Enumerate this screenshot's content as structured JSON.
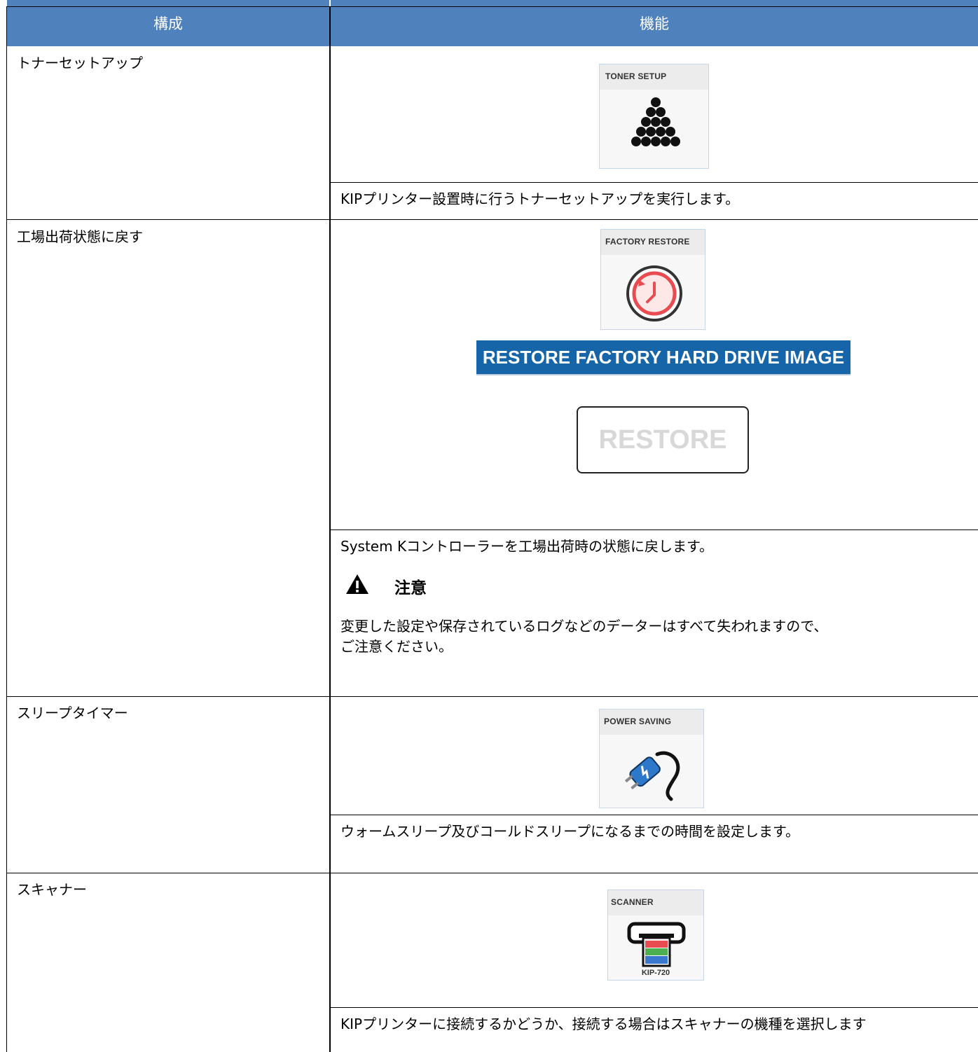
{
  "header": {
    "col1": "構成",
    "col2": "機能"
  },
  "rows": [
    {
      "label": "トナーセットアップ",
      "tile_caption": "TONER SETUP",
      "tile_icon": "toner-pile-icon",
      "description": "KIPプリンター設置時に行うトナーセットアップを実行します。"
    },
    {
      "label": "工場出荷状態に戻す",
      "tile_caption": "FACTORY RESTORE",
      "tile_icon": "restore-clock-icon",
      "banner": "RESTORE FACTORY HARD DRIVE IMAGE",
      "button": "RESTORE",
      "description": "System Kコントローラーを工場出荷時の状態に戻します。",
      "caution_title": "注意",
      "caution_line1": "変更した設定や保存されているログなどのデーターはすべて失われますので、",
      "caution_line2": "ご注意ください。"
    },
    {
      "label": "スリープタイマー",
      "tile_caption": "POWER SAVING",
      "tile_icon": "power-plug-icon",
      "description": "ウォームスリープ及びコールドスリープになるまでの時間を設定します。"
    },
    {
      "label": "スキャナー",
      "tile_caption": "SCANNER",
      "tile_model": "KIP-720",
      "tile_icon": "scanner-icon",
      "description": "KIPプリンターに接続するかどうか、接続する場合はスキャナーの機種を選択します"
    }
  ],
  "colors": {
    "header_bg": "#4f81bd",
    "banner_bg": "#1565a8",
    "warning": "#000000"
  }
}
